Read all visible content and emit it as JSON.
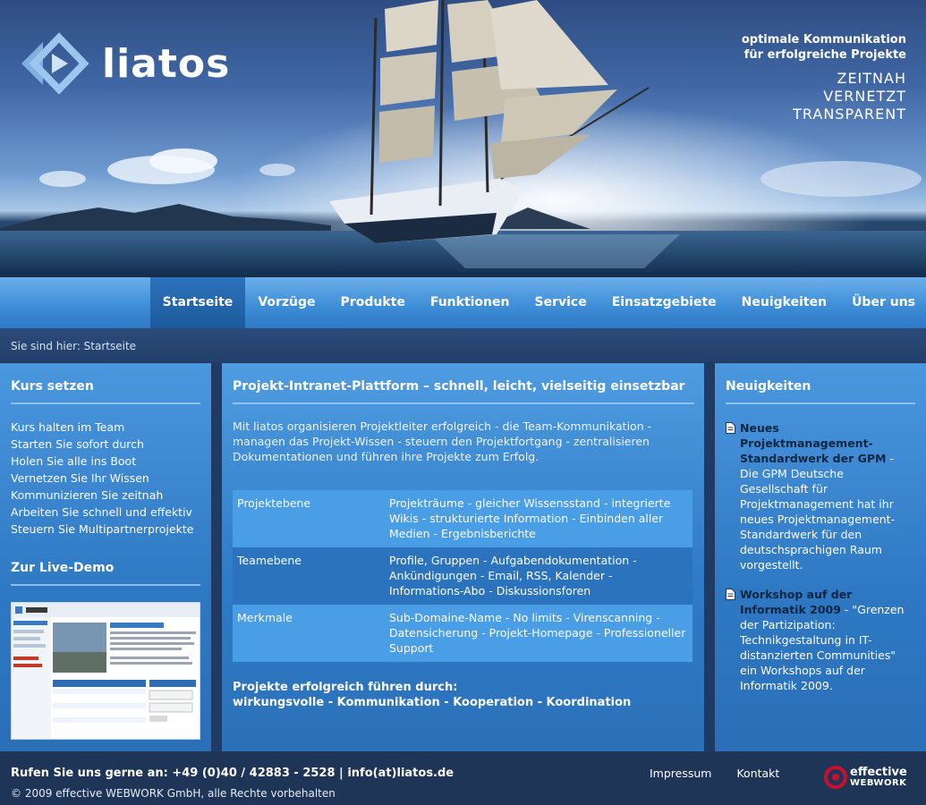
{
  "brand": {
    "name": "liatos"
  },
  "slogan": {
    "line1": "optimale Kommunikation",
    "line2": "für erfolgreiche Projekte",
    "claims": [
      "ZEITNAH",
      "VERNETZT",
      "TRANSPARENT"
    ]
  },
  "nav": {
    "items": [
      "Startseite",
      "Vorzüge",
      "Produkte",
      "Funktionen",
      "Service",
      "Einsatzgebiete",
      "Neuigkeiten",
      "Über uns"
    ],
    "active": "Startseite"
  },
  "breadcrumb": "Sie sind hier: Startseite",
  "left": {
    "title": "Kurs setzen",
    "links": [
      "Kurs halten im Team",
      "Starten Sie sofort durch",
      "Holen Sie alle ins Boot",
      "Vernetzen Sie Ihr Wissen",
      "Kommunizieren Sie zeitnah",
      "Arbeiten Sie schnell und effektiv",
      "Steuern Sie Multipartnerprojekte"
    ],
    "demo_title": "Zur Live-Demo"
  },
  "main": {
    "title": "Projekt-Intranet-Plattform – schnell, leicht, vielseitig einsetzbar",
    "intro": "Mit liatos organisieren Projektleiter erfolgreich - die Team-Kommunikation - managen das Projekt-Wissen - steuern den Projektfortgang - zentralisieren Dokumentationen und führen ihre Projekte zum Erfolg.",
    "features": [
      {
        "label": "Projektebene",
        "text": "Projekträume - gleicher Wissensstand - integrierte Wikis - strukturierte Information - Einbinden aller Medien - Ergebnisberichte"
      },
      {
        "label": "Teamebene",
        "text": "Profile, Gruppen - Aufgabendokumentation - Ankündigungen - Email, RSS, Kalender - Informations-Abo - Diskussionsforen"
      },
      {
        "label": "Merkmale",
        "text": "Sub-Domaine-Name - No limits - Virenscanning - Datensicherung - Projekt-Homepage - Professioneller Support"
      }
    ],
    "closing_line1": "Projekte erfolgreich führen durch:",
    "closing_line2": "wirkungsvolle - Kommunikation - Kooperation - Koordination"
  },
  "right": {
    "title": "Neuigkeiten",
    "news": [
      {
        "headline": "Neues Projektmanagement-Standardwerk der GPM",
        "sep": " - ",
        "body": "Die GPM Deutsche Gesellschaft für Projektmanagement hat ihr neues Projektmanagement-Standardwerk für den deutschsprachigen Raum vorgestellt."
      },
      {
        "headline": "Workshop auf der Informatik 2009",
        "sep": " - ",
        "body": "\"Grenzen der Partizipation: Technikgestaltung in IT-distanzierten Communities\" ein Workshops auf der Informatik 2009."
      }
    ]
  },
  "footer": {
    "phone": "Rufen Sie uns gerne an: +49 (0)40 / 42883 - 2528 | info(at)liatos.de",
    "copyright": "© 2009 effective WEBWORK GmbH, alle Rechte vorbehalten",
    "links": [
      "Impressum",
      "Kontakt"
    ],
    "partner_line1": "effective",
    "partner_line2": "WEBWORK"
  },
  "colors": {
    "nav_top": "#6aaee8",
    "nav_bottom": "#2f79c4",
    "panel": "#3a86d0",
    "row_light": "#4a9ee6",
    "row_dark": "#2b74bd",
    "footer": "#1e3557",
    "headline_dark": "#0d2643",
    "partner_red": "#c8102e"
  },
  "icons": [
    "liatos-logo-icon",
    "document-icon",
    "effective-webwork-logo-icon"
  ]
}
